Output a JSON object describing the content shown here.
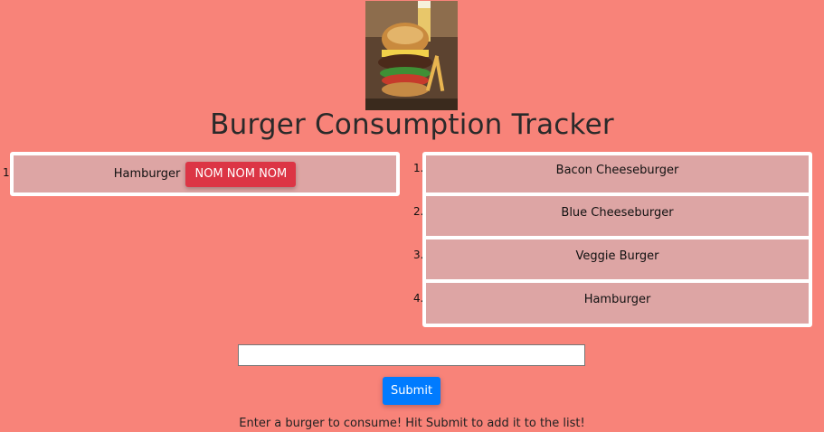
{
  "header": {
    "title": "Burger Consumption Tracker",
    "image_icon": "burger-photo"
  },
  "uneaten": {
    "items": [
      {
        "number": "1.",
        "name": "Hamburger",
        "button_label": "NOM NOM NOM"
      }
    ]
  },
  "eaten": {
    "items": [
      {
        "number": "1.",
        "name": "Bacon Cheeseburger"
      },
      {
        "number": "2.",
        "name": "Blue Cheeseburger"
      },
      {
        "number": "3.",
        "name": "Veggie Burger"
      },
      {
        "number": "4.",
        "name": "Hamburger"
      }
    ]
  },
  "form": {
    "input_value": "",
    "input_placeholder": "",
    "submit_label": "Submit",
    "help_text": "Enter a burger to consume! Hit Submit to add it to the list!"
  },
  "colors": {
    "background": "#f88379",
    "row": "#dda5a4",
    "devour_button": "#dc3545",
    "submit_button": "#007bff"
  }
}
